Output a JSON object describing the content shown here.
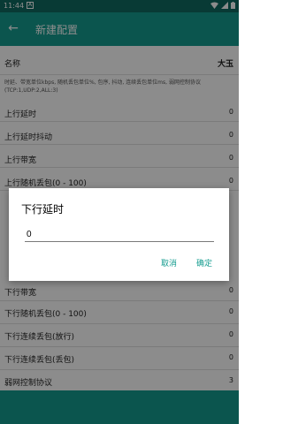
{
  "status": {
    "time": "11:44",
    "notif_icon": "A"
  },
  "appbar": {
    "title": "新建配置"
  },
  "config": {
    "name_label": "名称",
    "name_value": "大玉",
    "description": "时延、带宽单位kbps, 随机丢包单位%, 包序, 抖动, 连续丢包单位ms, 弱网控制协议(TCP:1,UDP:2,ALL:3)"
  },
  "rows": [
    {
      "label": "上行延时",
      "value": "0"
    },
    {
      "label": "上行延时抖动",
      "value": "0"
    },
    {
      "label": "上行带宽",
      "value": "0"
    },
    {
      "label": "上行随机丢包(0 - 100)",
      "value": "0"
    },
    {
      "label": "下行带宽",
      "value": "0"
    },
    {
      "label": "下行随机丢包(0 - 100)",
      "value": "0"
    },
    {
      "label": "下行连续丢包(放行)",
      "value": "0"
    },
    {
      "label": "下行连续丢包(丢包)",
      "value": "0"
    },
    {
      "label": "弱网控制协议",
      "value": "3"
    }
  ],
  "dialog": {
    "title": "下行延时",
    "input_value": "0",
    "cancel": "取消",
    "confirm": "确定"
  }
}
